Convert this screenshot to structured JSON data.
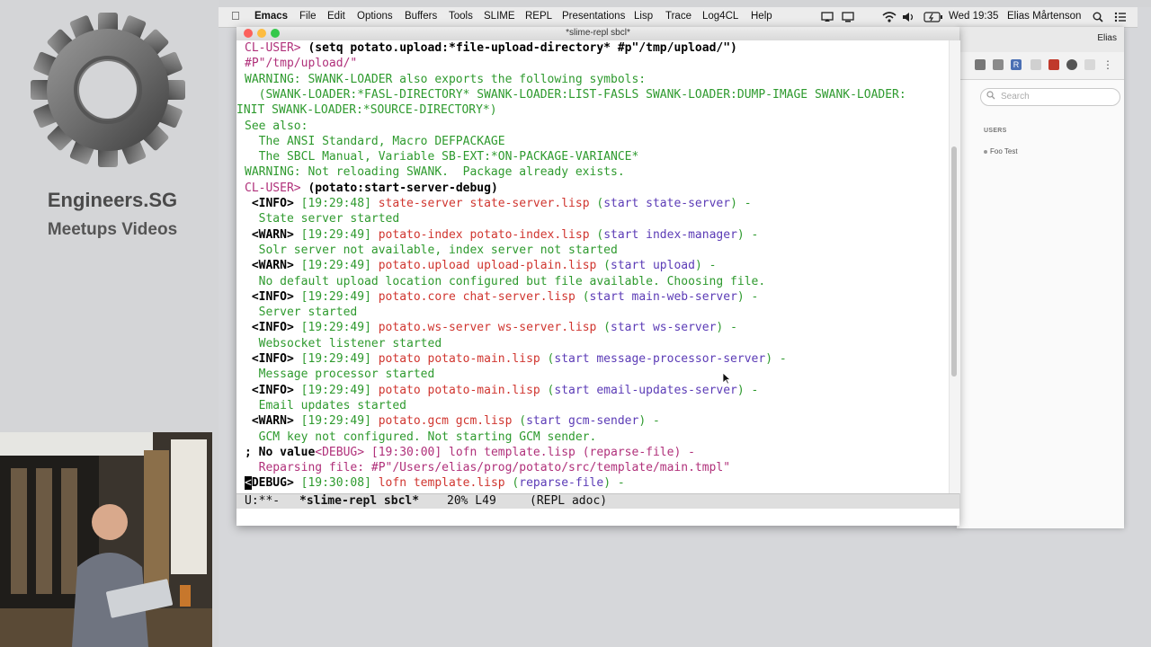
{
  "brand": {
    "title": "Engineers.SG",
    "subtitle": "Meetups Videos"
  },
  "menubar": {
    "app": "Emacs",
    "items": [
      "File",
      "Edit",
      "Options",
      "Buffers",
      "Tools",
      "SLIME",
      "REPL",
      "Presentations",
      "Lisp",
      "Trace",
      "Log4CL",
      "Help"
    ],
    "clock": "Wed 19:35",
    "user": "Elias Mårtenson"
  },
  "browser": {
    "user": "Elias",
    "search_placeholder": "Search",
    "users_heading": "USERS",
    "user_item": "Foo Test"
  },
  "emacs": {
    "window_title": "*slime-repl sbcl*",
    "lines": {
      "l1a": "CL-USER> ",
      "l1b": "(setq potato.upload:*file-upload-directory* #p\"/tmp/upload/\")",
      "l2": "#P\"/tmp/upload/\"",
      "l3": "WARNING: SWANK-LOADER also exports the following symbols:",
      "l4": "  (SWANK-LOADER:*FASL-DIRECTORY* SWANK-LOADER:LIST-FASLS SWANK-LOADER:DUMP-IMAGE SWANK-LOADER:",
      "l5": "INIT SWANK-LOADER:*SOURCE-DIRECTORY*)",
      "l6": "See also:",
      "l7": "  The ANSI Standard, Macro DEFPACKAGE",
      "l8": "  The SBCL Manual, Variable SB-EXT:*ON-PACKAGE-VARIANCE*",
      "l9": "WARNING: Not reloading SWANK.  Package already exists.",
      "l10a": "CL-USER> ",
      "l10b": "(potato:start-server-debug)",
      "log": [
        {
          "tag": " <INFO>",
          "time": " [19:29:48] ",
          "name": "state-server state-server.lisp",
          "fn1": " (",
          "fn2": "start state-server",
          "fn3": ") -",
          "msg": "  State server started"
        },
        {
          "tag": " <WARN>",
          "time": " [19:29:49] ",
          "name": "potato-index potato-index.lisp",
          "fn1": " (",
          "fn2": "start index-manager",
          "fn3": ") -",
          "msg": "  Solr server not available, index server not started"
        },
        {
          "tag": " <WARN>",
          "time": " [19:29:49] ",
          "name": "potato.upload upload-plain.lisp",
          "fn1": " (",
          "fn2": "start upload",
          "fn3": ") -",
          "msg": "  No default upload location configured but file available. Choosing file."
        },
        {
          "tag": " <INFO>",
          "time": " [19:29:49] ",
          "name": "potato.core chat-server.lisp",
          "fn1": " (",
          "fn2": "start main-web-server",
          "fn3": ") -",
          "msg": "  Server started"
        },
        {
          "tag": " <INFO>",
          "time": " [19:29:49] ",
          "name": "potato.ws-server ws-server.lisp",
          "fn1": " (",
          "fn2": "start ws-server",
          "fn3": ") -",
          "msg": "  Websocket listener started"
        },
        {
          "tag": " <INFO>",
          "time": " [19:29:49] ",
          "name": "potato potato-main.lisp",
          "fn1": " (",
          "fn2": "start message-processor-server",
          "fn3": ") -",
          "msg": "  Message processor started"
        },
        {
          "tag": " <INFO>",
          "time": " [19:29:49] ",
          "name": "potato potato-main.lisp",
          "fn1": " (",
          "fn2": "start email-updates-server",
          "fn3": ") -",
          "msg": "  Email updates started"
        },
        {
          "tag": " <WARN>",
          "time": " [19:29:49] ",
          "name": "potato.gcm gcm.lisp",
          "fn1": " (",
          "fn2": "start gcm-sender",
          "fn3": ") -",
          "msg": "  GCM key not configured. Not starting GCM sender."
        }
      ],
      "l27a": "; No value",
      "l27b": "<DEBUG>",
      "l27c": " [19:30:00] lofn template.lisp (reparse-file) -",
      "l28": "  Reparsing file: #P\"/Users/elias/prog/potato/src/template/main.tmpl\"",
      "l29a": "<",
      "l29b": "DEBUG>",
      "l29c": " [19:30:08] ",
      "l29d": "lofn template.lisp",
      "l29e": " (",
      "l29f": "reparse-file",
      "l29g": ") -"
    },
    "modeline": {
      "state": "U:**-",
      "buffer": "*slime-repl sbcl*",
      "position": "20% L49",
      "modes": "(REPL adoc)"
    }
  },
  "colors": {
    "prompt": "#b0307a",
    "output": "#2e9a2e",
    "logname": "#d0352f",
    "function": "#5b3bb6"
  }
}
